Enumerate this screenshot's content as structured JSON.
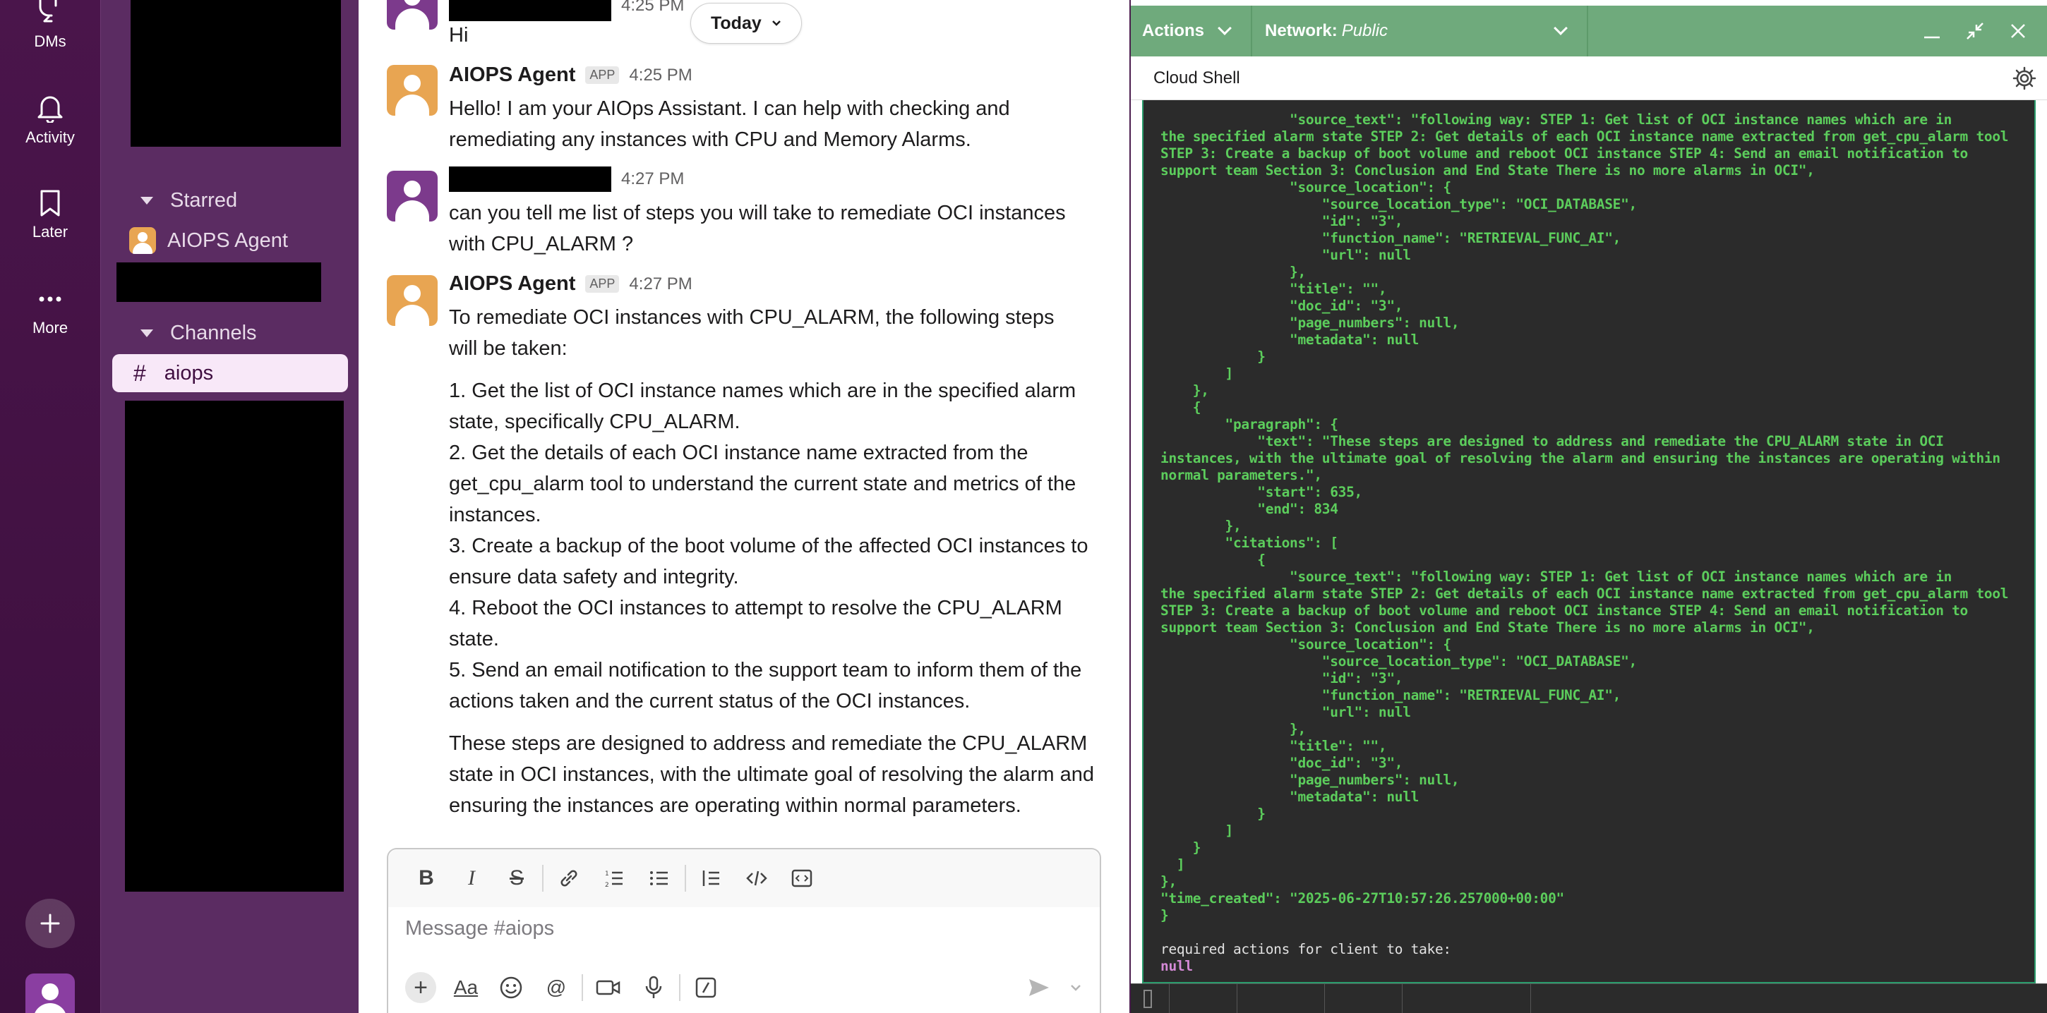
{
  "rail": {
    "dms_label": "DMs",
    "activity_label": "Activity",
    "later_label": "Later",
    "more_label": "More"
  },
  "sidebar": {
    "starred_label": "Starred",
    "starred_items": [
      {
        "label": "AIOPS Agent"
      }
    ],
    "channels_label": "Channels",
    "channels": [
      {
        "label": "aiops",
        "selected": true
      }
    ]
  },
  "chat": {
    "today_label": "Today",
    "messages": [
      {
        "sender": "",
        "time": "4:25 PM",
        "text": "Hi"
      },
      {
        "sender": "AIOPS Agent",
        "badge": "APP",
        "time": "4:25 PM",
        "text": "Hello! I am your AIOps Assistant. I can help with checking and remediating any instances with CPU and Memory Alarms."
      },
      {
        "sender": "",
        "time": "4:27 PM",
        "text": "can you tell me list of steps you will take to remediate OCI instances with CPU_ALARM ?"
      },
      {
        "sender": "AIOPS Agent",
        "badge": "APP",
        "time": "4:27 PM",
        "intro": "To remediate OCI instances with CPU_ALARM, the following steps will be taken:",
        "steps": [
          "1. Get the list of OCI instance names which are in the specified alarm state, specifically CPU_ALARM.",
          "2. Get the details of each OCI instance name extracted from the get_cpu_alarm tool to understand the current state and metrics of the instances.",
          "3. Create a backup of the boot volume of the affected OCI instances to ensure data safety and integrity.",
          "4. Reboot the OCI instances to attempt to resolve the CPU_ALARM state.",
          "5. Send an email notification to the support team to inform them of the actions taken and the current status of the OCI instances."
        ],
        "outro": "These steps are designed to address and remediate the CPU_ALARM state in OCI instances, with the ultimate goal of resolving the alarm and ensuring the instances are operating within normal parameters."
      }
    ],
    "composer": {
      "placeholder": "Message #aiops"
    }
  },
  "shell": {
    "actions_label": "Actions",
    "network_label": "Network:",
    "network_value": "Public",
    "title": "Cloud Shell",
    "terminal_lines": [
      "                \"source_text\": \"following way: STEP 1: Get list of OCI instance names which are in",
      "the specified alarm state STEP 2: Get details of each OCI instance name extracted from get_cpu_alarm tool",
      "STEP 3: Create a backup of boot volume and reboot OCI instance STEP 4: Send an email notification to",
      "support team Section 3: Conclusion and End State There is no more alarms in OCI\",",
      "                \"source_location\": {",
      "                    \"source_location_type\": \"OCI_DATABASE\",",
      "                    \"id\": \"3\",",
      "                    \"function_name\": \"RETRIEVAL_FUNC_AI\",",
      "                    \"url\": null",
      "                },",
      "                \"title\": \"\",",
      "                \"doc_id\": \"3\",",
      "                \"page_numbers\": null,",
      "                \"metadata\": null",
      "            }",
      "        ]",
      "    },",
      "    {",
      "        \"paragraph\": {",
      "            \"text\": \"These steps are designed to address and remediate the CPU_ALARM state in OCI",
      "instances, with the ultimate goal of resolving the alarm and ensuring the instances are operating within",
      "normal parameters.\",",
      "            \"start\": 635,",
      "            \"end\": 834",
      "        },",
      "        \"citations\": [",
      "            {",
      "                \"source_text\": \"following way: STEP 1: Get list of OCI instance names which are in",
      "the specified alarm state STEP 2: Get details of each OCI instance name extracted from get_cpu_alarm tool",
      "STEP 3: Create a backup of boot volume and reboot OCI instance STEP 4: Send an email notification to",
      "support team Section 3: Conclusion and End State There is no more alarms in OCI\",",
      "                \"source_location\": {",
      "                    \"source_location_type\": \"OCI_DATABASE\",",
      "                    \"id\": \"3\",",
      "                    \"function_name\": \"RETRIEVAL_FUNC_AI\",",
      "                    \"url\": null",
      "                },",
      "                \"title\": \"\",",
      "                \"doc_id\": \"3\",",
      "                \"page_numbers\": null,",
      "                \"metadata\": null",
      "            }",
      "        ]",
      "    }",
      "  ]",
      "},",
      "\"time_created\": \"2025-06-27T10:57:26.257000+00:00\"",
      "}"
    ],
    "footer_label": "required actions for client to take:",
    "footer_value": "null"
  }
}
